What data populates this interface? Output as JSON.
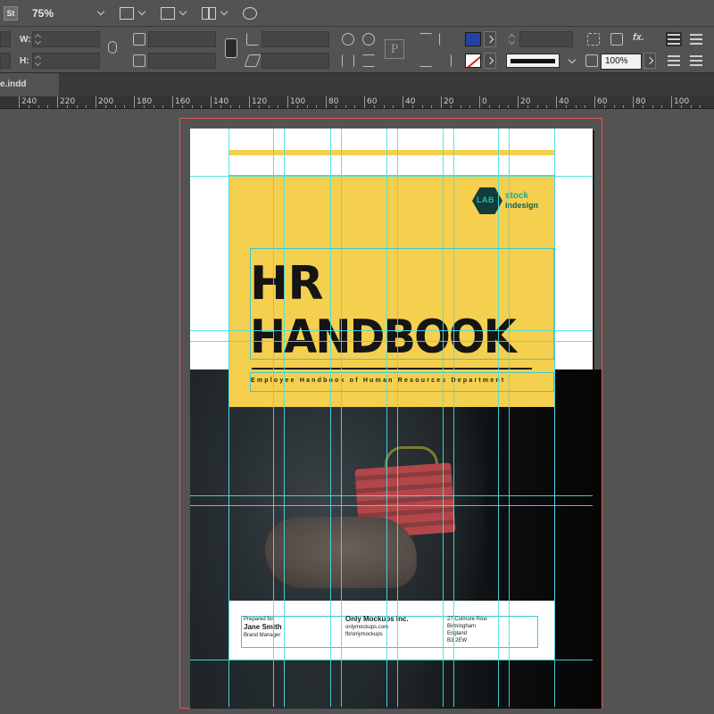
{
  "app": {
    "logo": "St",
    "zoom_level": "75%"
  },
  "control_panel": {
    "w_label": "W:",
    "h_label": "H:",
    "stroke_percent": "100%",
    "fx_label": "fx.",
    "p_icon_label": "P"
  },
  "document_tab": {
    "name": "e.indd"
  },
  "ruler": {
    "ticks": [
      "240",
      "220",
      "200",
      "180",
      "160",
      "140",
      "120",
      "100",
      "80",
      "60",
      "40",
      "20",
      "0",
      "20",
      "40",
      "60",
      "80",
      "100"
    ]
  },
  "cover": {
    "logo_hex_text": "LAB",
    "logo_line1": "stock",
    "logo_line2": "indesign",
    "title_line1": "HR",
    "title_line2": "HANDBOOK",
    "subtitle": "Employee Handbook of Human Resources Department",
    "footer": {
      "col1_label": "Prepared for:",
      "col1_name": "Jane Smith",
      "col1_role": "Brand Manager",
      "col2_company": "Only Mockups Inc.",
      "col2_web": "onlymockups.com",
      "col2_social": "fb/onlymockups",
      "col3_line1": "27 Colmore Row",
      "col3_line2": "Birmingham",
      "col3_line3": "England",
      "col3_line4": "B3 2EW"
    }
  },
  "colors": {
    "accent_yellow": "#f5cf4e",
    "guide_cyan": "#48e0e0",
    "bleed_red": "#e0584f",
    "fill_swatch": "#2541a6"
  }
}
